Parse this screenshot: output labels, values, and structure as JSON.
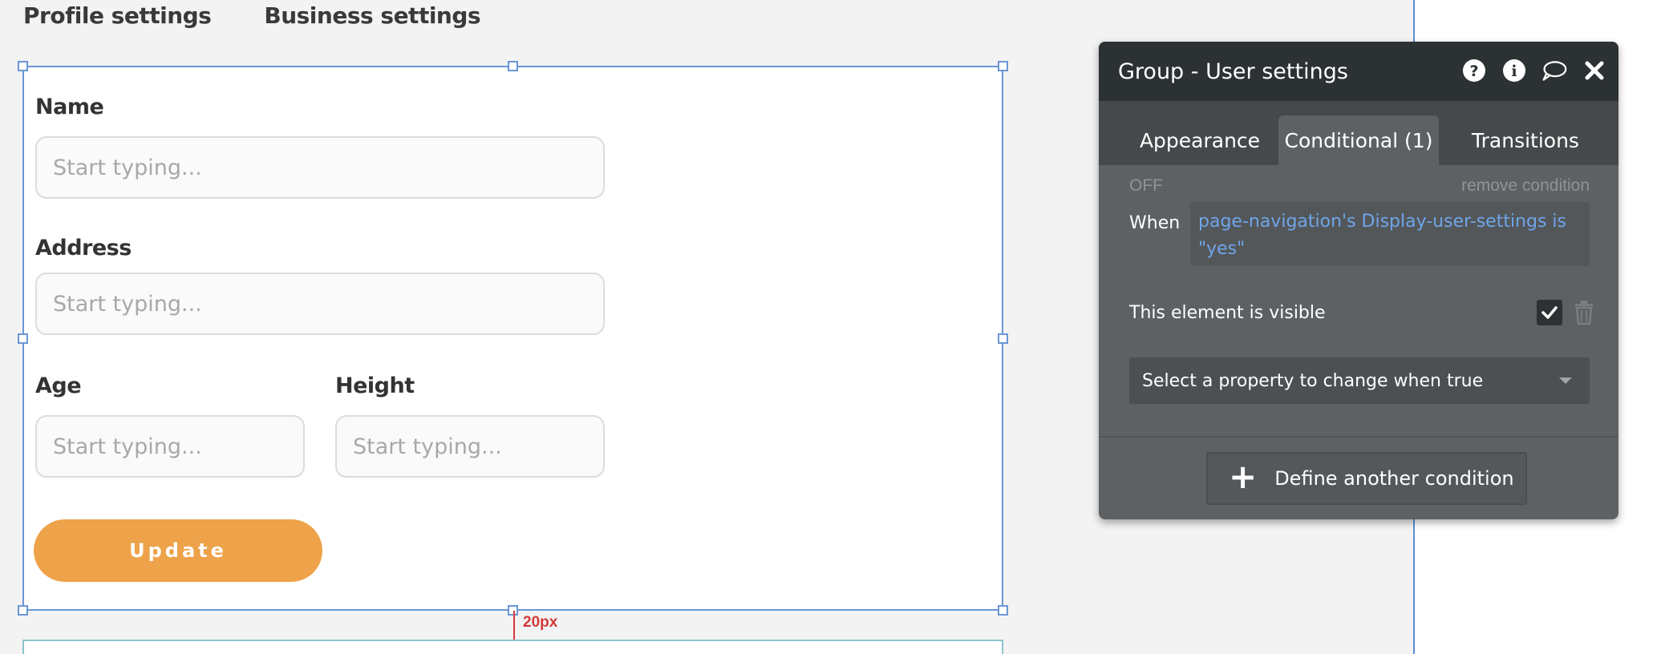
{
  "top_tabs": [
    {
      "label": "Profile settings"
    },
    {
      "label": "Business settings"
    }
  ],
  "form": {
    "name_label": "Name",
    "name_placeholder": "Start typing...",
    "address_label": "Address",
    "address_placeholder": "Start typing...",
    "age_label": "Age",
    "age_placeholder": "Start typing...",
    "height_label": "Height",
    "height_placeholder": "Start typing...",
    "update_label": "Update"
  },
  "spacing_indicator": "20px",
  "panel": {
    "title": "Group - User settings",
    "tabs": [
      {
        "label": "Appearance"
      },
      {
        "label": "Conditional (1)"
      },
      {
        "label": "Transitions"
      }
    ],
    "off_label": "OFF",
    "remove_label": "remove condition",
    "when_label": "When",
    "when_expression": "page-navigation's Display-user-settings is \"yes\"",
    "visible_label": "This element is visible",
    "select_placeholder": "Select a property to change when true",
    "define_label": "Define another condition"
  },
  "colors": {
    "accent_button": "#eea249",
    "selection_border": "#6b96d6",
    "expression_text": "#6fa5e8",
    "spacing_marker": "#d33a3a"
  }
}
